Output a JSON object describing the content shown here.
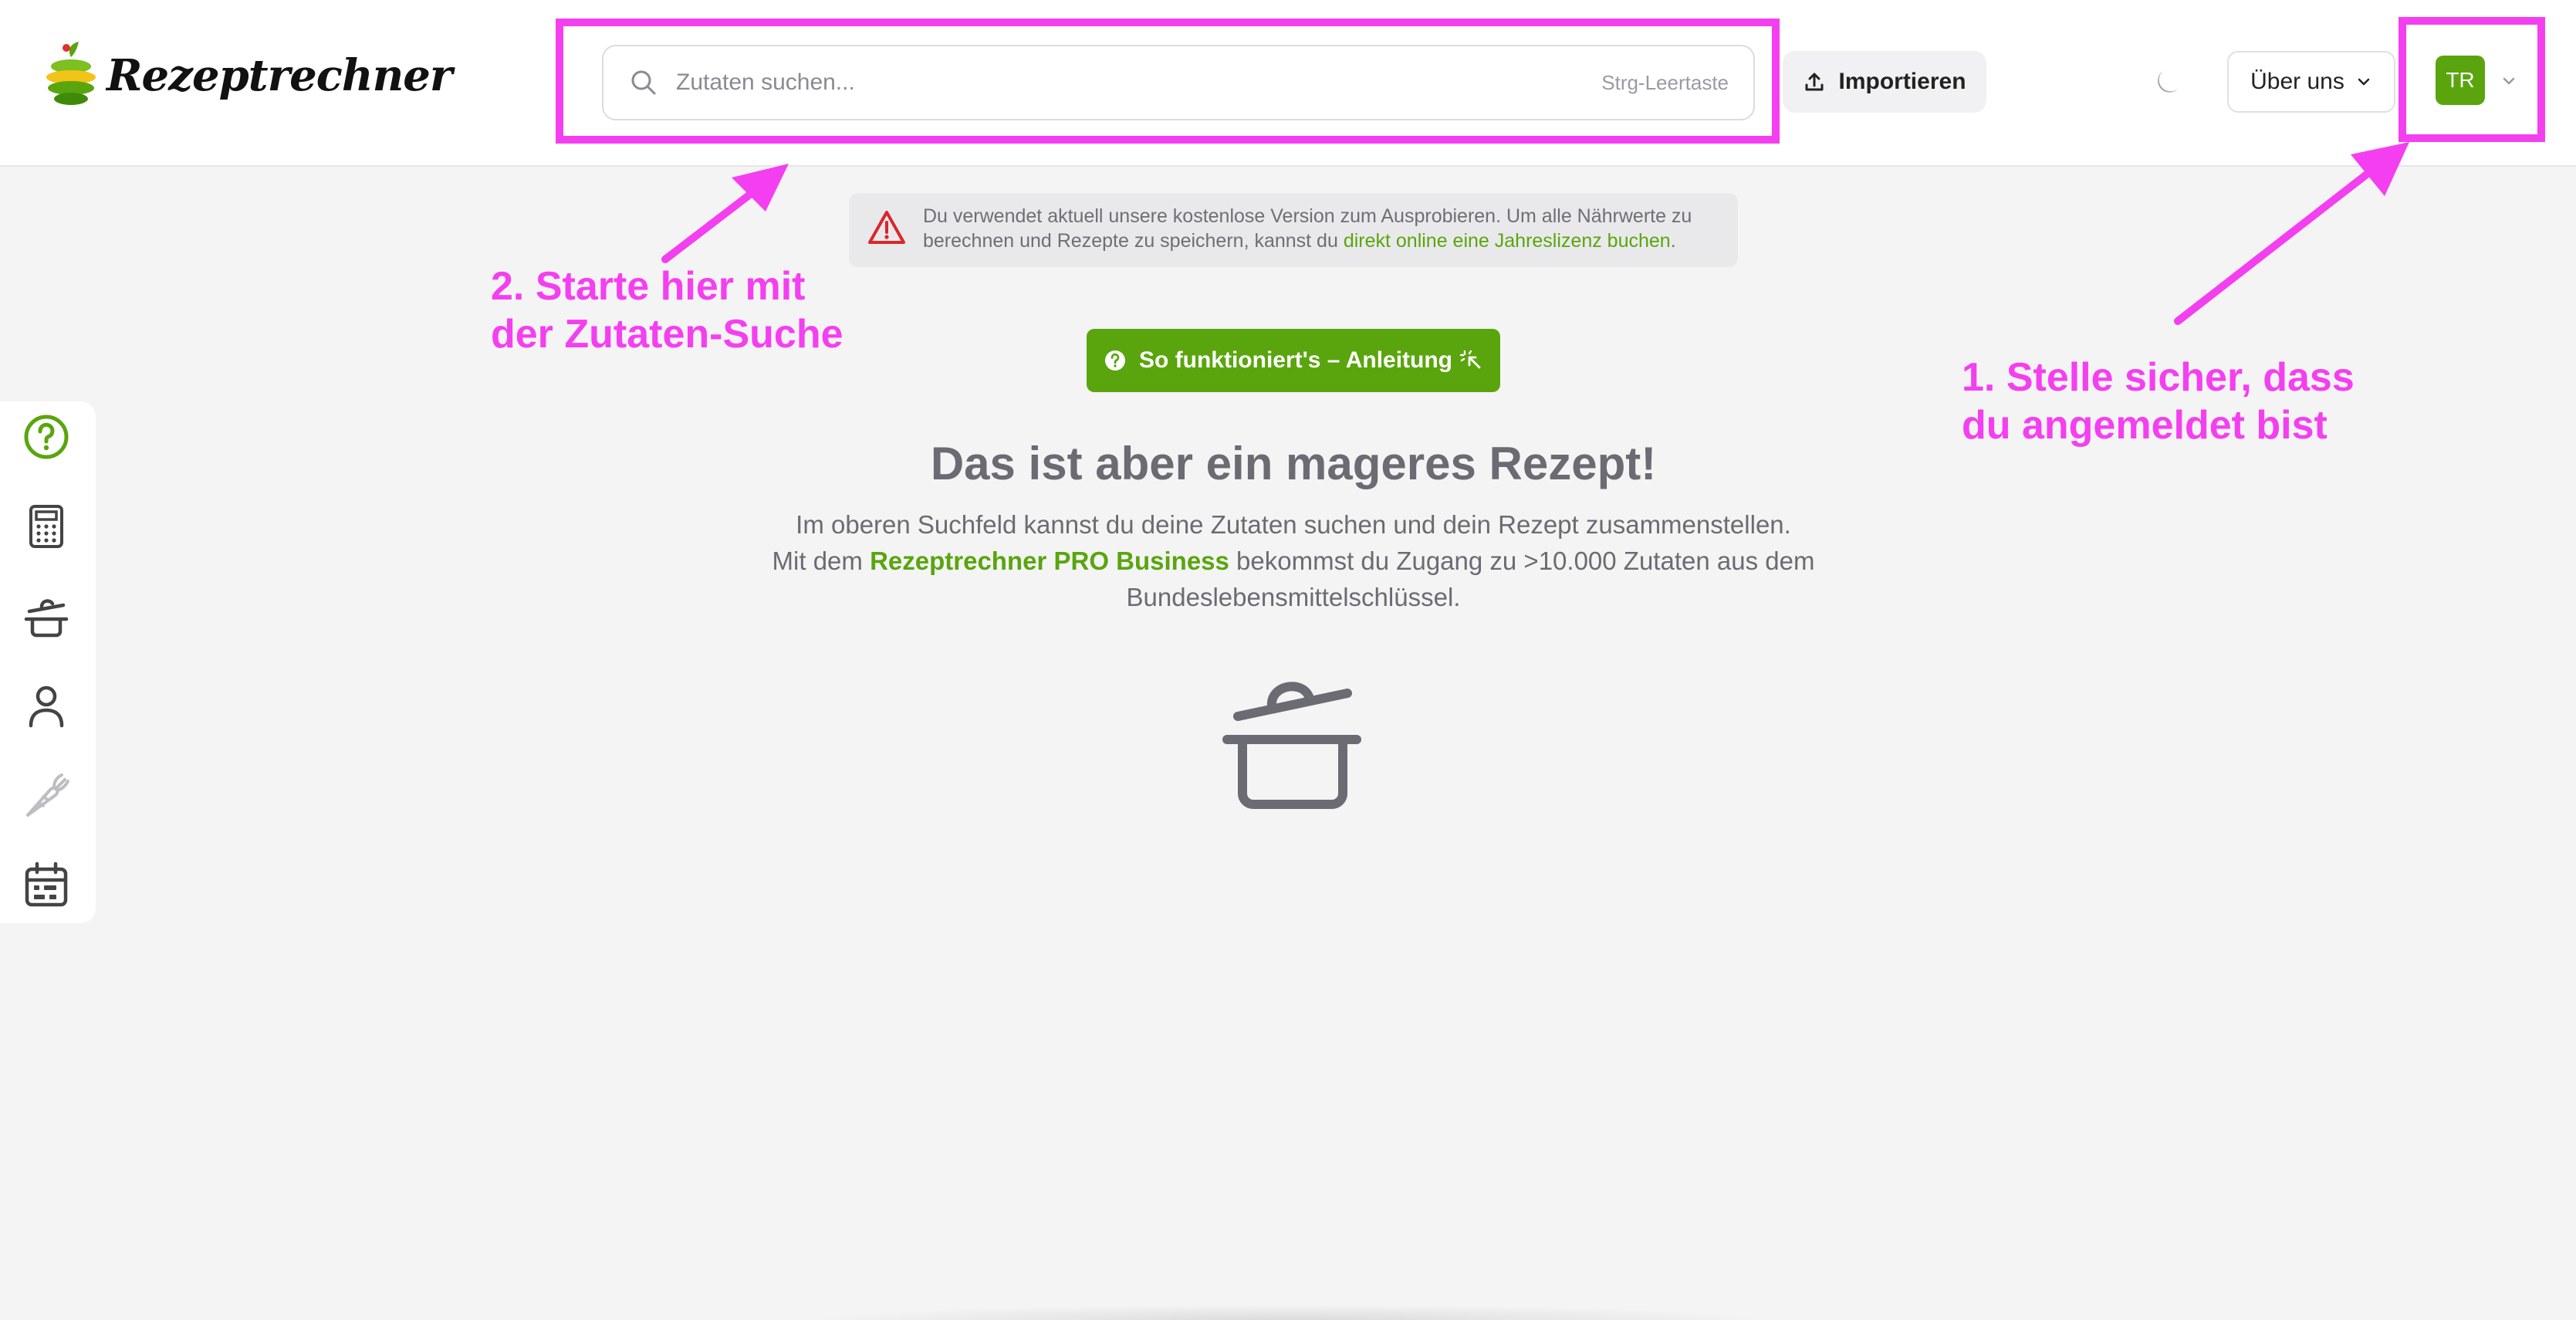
{
  "header": {
    "logo_text": "Rezeptrechner",
    "search": {
      "placeholder": "Zutaten suchen...",
      "value": "",
      "shortcut": "Strg-Leertaste"
    },
    "import_label": "Importieren",
    "about_label": "Über uns",
    "avatar_initials": "TR"
  },
  "notice": {
    "text_before": "Du verwendet aktuell unsere kostenlose Version zum Ausprobieren. Um alle Nährwerte zu berechnen und Rezepte zu speichern, kannst du ",
    "link": "direkt online eine Jahreslizenz buchen",
    "text_after": "."
  },
  "guide_button": "So funktioniert's – Anleitung",
  "empty_state": {
    "title": "Das ist aber ein mageres Rezept!",
    "line1": "Im oberen Suchfeld kannst du deine Zutaten suchen und dein Rezept zusammenstellen.",
    "line2_before": "Mit dem ",
    "line2_link": "Rezeptrechner PRO Business",
    "line2_after": " bekommst du Zugang zu >10.000 Zutaten aus dem Bundeslebensmittelschlüssel."
  },
  "annotations": {
    "step1_line1": "1. Stelle sicher, dass",
    "step1_line2": "du angemeldet bist",
    "step2_line1": "2. Starte hier mit",
    "step2_line2": "der Zutaten-Suche"
  },
  "sidebar": {
    "items": [
      {
        "icon": "help-circle-icon"
      },
      {
        "icon": "calculator-icon"
      },
      {
        "icon": "pot-icon"
      },
      {
        "icon": "user-icon"
      },
      {
        "icon": "carrot-icon"
      },
      {
        "icon": "calendar-icon"
      }
    ]
  },
  "colors": {
    "accent": "#5aa50e",
    "annotation": "#f43ff0",
    "warning": "#d9262b"
  }
}
